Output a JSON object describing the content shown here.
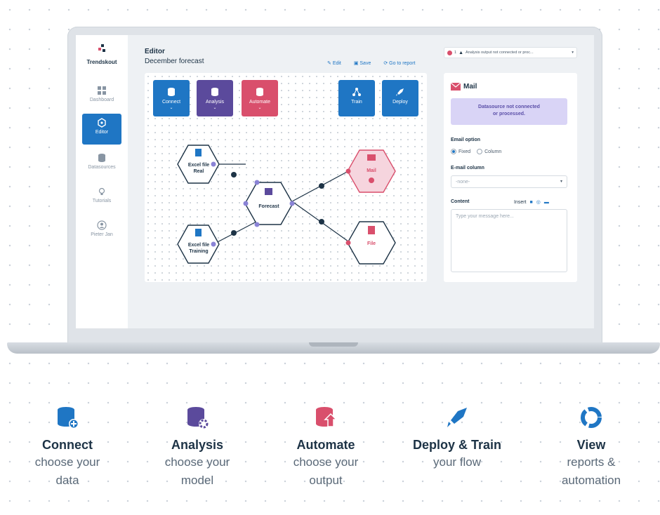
{
  "app": {
    "brand": "Trendskout"
  },
  "sidebar": {
    "items": [
      {
        "label": "Dashboard",
        "icon": "dashboard-icon"
      },
      {
        "label": "Editor",
        "icon": "editor-icon",
        "active": true
      },
      {
        "label": "Datasources",
        "icon": "database-icon"
      },
      {
        "label": "Tutorials",
        "icon": "lightbulb-icon"
      },
      {
        "label": "Pieter Jan",
        "icon": "user-icon"
      }
    ]
  },
  "header": {
    "title": "Editor",
    "subtitle": "December forecast",
    "actions": {
      "edit": "Edit",
      "save": "Save",
      "report": "Go to report"
    },
    "alert": {
      "count": "1",
      "text": "Analysis output not connected or proc..."
    }
  },
  "toolbar": {
    "connect": "Connect",
    "analysis": "Analysis",
    "automate": "Automate",
    "train": "Train",
    "deploy": "Deploy"
  },
  "flow": {
    "excel_real": [
      "Excel file",
      "Real"
    ],
    "excel_training": [
      "Excel file",
      "Training"
    ],
    "forecast": "Forecast",
    "mail": "Mail",
    "file": "File"
  },
  "panel": {
    "title": "Mail",
    "datasource_msg": [
      "Datasource not connected",
      "or processed."
    ],
    "email_option_label": "Email option",
    "radio_fixed": "Fixed",
    "radio_column": "Column",
    "email_column_label": "E-mail column",
    "email_column_value": "-none-",
    "content_label": "Content",
    "insert_label": "Insert",
    "content_placeholder": "Type your message here..."
  },
  "features": [
    {
      "title": "Connect",
      "desc": "choose your\ndata",
      "icon": "database-add-icon"
    },
    {
      "title": "Analysis",
      "desc": "choose your\nmodel",
      "icon": "database-settings-icon"
    },
    {
      "title": "Automate",
      "desc": "choose your\noutput",
      "icon": "database-export-icon"
    },
    {
      "title": "Deploy & Train",
      "desc": "your flow",
      "icon": "rocket-icon"
    },
    {
      "title": "View",
      "desc": "reports &\nautomation",
      "icon": "chart-ring-icon"
    }
  ],
  "colors": {
    "blue": "#1f76c4",
    "purple": "#5b4a9c",
    "pink": "#d94f6c",
    "navy": "#1d3346"
  }
}
